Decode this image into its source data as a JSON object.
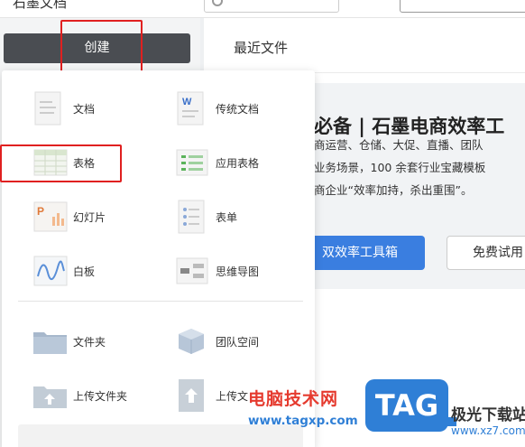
{
  "header": {
    "app_title": "石墨文档"
  },
  "sidebar": {
    "create_label": "创建"
  },
  "main": {
    "recent_title": "最近文件",
    "banner": {
      "title": "必备 | 石墨电商效率工",
      "lines": [
        "商运营、仓储、大促、直播、团队",
        "业务场景，100 余套行业宝藏模板",
        "商企业“效率加持，杀出重围”。"
      ],
      "primary_button": "双效率工具箱",
      "secondary_button": "免费试用"
    }
  },
  "dropdown": {
    "items": [
      {
        "label": "文档",
        "icon": "doc-icon"
      },
      {
        "label": "传统文档",
        "icon": "word-doc-icon"
      },
      {
        "label": "表格",
        "icon": "sheet-icon"
      },
      {
        "label": "应用表格",
        "icon": "app-sheet-icon"
      },
      {
        "label": "幻灯片",
        "icon": "slides-icon"
      },
      {
        "label": "表单",
        "icon": "form-icon"
      },
      {
        "label": "白板",
        "icon": "whiteboard-icon"
      },
      {
        "label": "思维导图",
        "icon": "mindmap-icon"
      },
      {
        "label": "文件夹",
        "icon": "folder-icon"
      },
      {
        "label": "团队空间",
        "icon": "team-space-icon"
      },
      {
        "label": "上传文件夹",
        "icon": "upload-folder-icon"
      },
      {
        "label": "上传文",
        "icon": "upload-file-icon"
      }
    ]
  },
  "watermark": {
    "site_name": "电脑技术网",
    "url": "www.tagxp.com",
    "tag": "TAG",
    "right_name": "极光下载站",
    "right_url": "www.xz7.com"
  },
  "colors": {
    "create_button": "#4a4d52",
    "highlight": "#e02020",
    "primary": "#3a7ee0"
  }
}
